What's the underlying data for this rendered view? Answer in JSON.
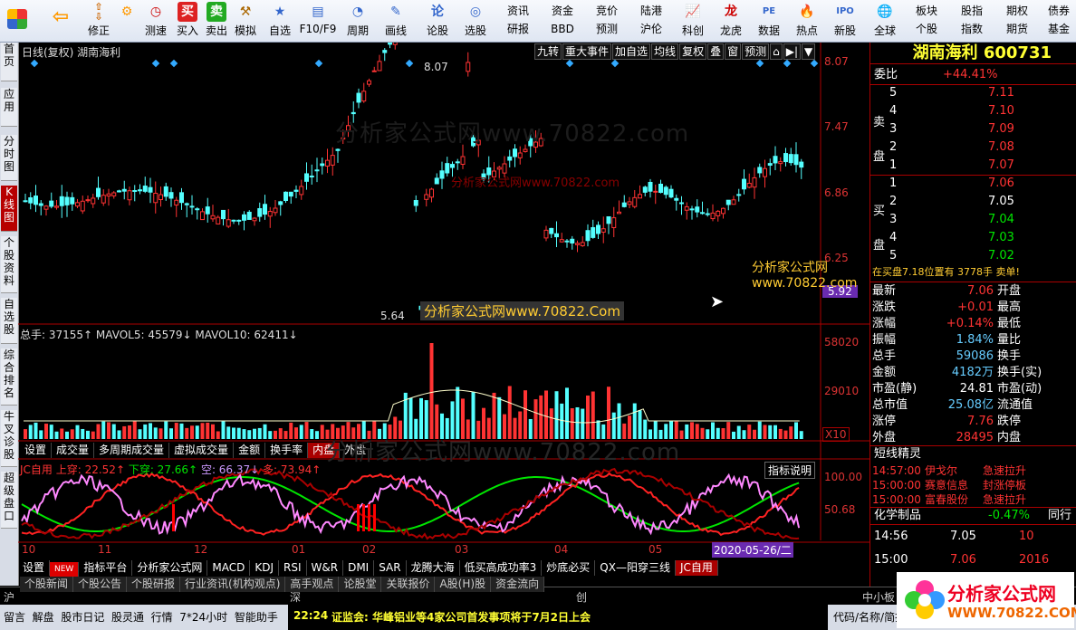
{
  "toolbar": {
    "items": [
      "买入",
      "卖出",
      "模拟",
      "自选",
      "F10/F9",
      "周期",
      "画线",
      "论股",
      "选股"
    ],
    "small_buttons_top": [
      "资讯",
      "资金",
      "竞价",
      "陆港"
    ],
    "small_buttons_bottom": [
      "研报",
      "BBD",
      "预测",
      "沪伦"
    ],
    "right_items": [
      "科创",
      "龙虎",
      "数据",
      "热点",
      "新股",
      "全球"
    ],
    "right_small_top": [
      "板块",
      "股指",
      "期权",
      "债券"
    ],
    "right_small_bottom": [
      "个股",
      "指数",
      "期货",
      "基金"
    ],
    "nav_labels": [
      "修正",
      "测速"
    ]
  },
  "leftbar": [
    "首页",
    "应用",
    "分时图",
    "K线图",
    "个股资料",
    "自选股",
    "综合排名",
    "牛叉诊股",
    "超级盘口"
  ],
  "chart": {
    "title": "日线(复权)  湖南海利",
    "buttons": [
      "九转",
      "重大事件",
      "加自选",
      "均线",
      "复权",
      "叠",
      "窗",
      "预测"
    ],
    "price_ticks": [
      "8.07",
      "7.47",
      "6.86",
      "6.25",
      "5.92"
    ],
    "high_label": "8.07",
    "low_label": "5.64",
    "vol_header": "总手: 37155↑  MAVOL5: 45579↓  MAVOL10: 62411↓",
    "vol_ticks": [
      "58020",
      "29010",
      "X10"
    ],
    "vol_tabs": [
      "设置",
      "成交量",
      "多周期成交量",
      "虚拟成交量",
      "金额",
      "换手率",
      "内盘",
      "外盘"
    ],
    "ind_header_pre": "JC自用  上穿: 22.52↑",
    "ind_header_mid": "下穿: 27.66↑",
    "ind_header_kong": "空: 66.37↓",
    "ind_header_duo": "多: 73.94↑",
    "ind_help": "指标说明",
    "ind_ticks": [
      "100.00",
      "50.68"
    ],
    "months": [
      "10",
      "11",
      "12",
      "01",
      "02",
      "03",
      "04",
      "05"
    ],
    "cursor_date": "2020-05-26/二",
    "bottom_tabs": [
      "设置",
      "NEW",
      "指标平台",
      "分析家公式网",
      "MACD",
      "KDJ",
      "RSI",
      "W&R",
      "DMI",
      "SAR",
      "龙腾大海",
      "低买高成功率3",
      "炒底必买",
      "QX—阳穿三线",
      "JC自用"
    ],
    "watermark": "分析家公式网www.70822.com",
    "watermark2": "分析家公式网www.70822.Com"
  },
  "quote": {
    "name": "湖南海利",
    "code": "600731",
    "wei_bi_label": "委比",
    "wei_bi": "+44.41%",
    "sell_label": "卖盘",
    "buy_label": "买盘",
    "sells": [
      [
        "5",
        "7.11"
      ],
      [
        "4",
        "7.10"
      ],
      [
        "3",
        "7.09"
      ],
      [
        "2",
        "7.08"
      ],
      [
        "1",
        "7.07"
      ]
    ],
    "buys": [
      [
        "1",
        "7.06"
      ],
      [
        "2",
        "7.05"
      ],
      [
        "3",
        "7.04"
      ],
      [
        "4",
        "7.03"
      ],
      [
        "5",
        "7.02"
      ]
    ],
    "notice": "在买盘7.18位置有   3778手   卖单!",
    "stats": [
      [
        "最新",
        "7.06",
        "开盘"
      ],
      [
        "涨跌",
        "+0.01",
        "最高"
      ],
      [
        "涨幅",
        "+0.14%",
        "最低"
      ],
      [
        "振幅",
        "1.84%",
        "量比"
      ],
      [
        "总手",
        "59086",
        "换手"
      ],
      [
        "金额",
        "4182万",
        "换手(实)"
      ],
      [
        "市盈(静)",
        "24.81",
        "市盈(动)"
      ],
      [
        "总市值",
        "25.08亿",
        "流通值"
      ],
      [
        "涨停",
        "7.76",
        "跌停"
      ],
      [
        "外盘",
        "28495",
        "内盘"
      ]
    ],
    "short_title": "短线精灵",
    "short_list": [
      [
        "14:57:00",
        "伊戈尔",
        "急速拉升"
      ],
      [
        "15:00:00",
        "赛意信息",
        "封涨停板"
      ],
      [
        "15:00:00",
        "富春股份",
        "急速拉升"
      ]
    ],
    "sector": [
      "化学制品",
      "-0.47%",
      "同行"
    ],
    "ticks": [
      [
        "14:56",
        "7.05",
        "10"
      ],
      [
        "15:00",
        "7.06",
        "2016"
      ]
    ]
  },
  "bottom": {
    "tabs1": [
      "个股新闻",
      "个股公告",
      "个股研报",
      "行业资讯(机构观点)",
      "高手观点",
      "论股堂",
      "关联报价",
      "A股(H)股",
      "资金流向"
    ],
    "index_bar": [
      "沪",
      "深",
      "创",
      "中小板"
    ],
    "status_items": [
      "留言",
      "解盘",
      "股市日记",
      "股灵通",
      "行情",
      "7*24小时",
      "智能助手"
    ],
    "news_time": "22:24",
    "news": "证监会: 华峰铝业等4家公司首发事项将于7月2日上会",
    "search_hint": "代码/名称/简拼",
    "logo_text": "分析家公式网",
    "logo_url": "WWW.70822.COM"
  }
}
